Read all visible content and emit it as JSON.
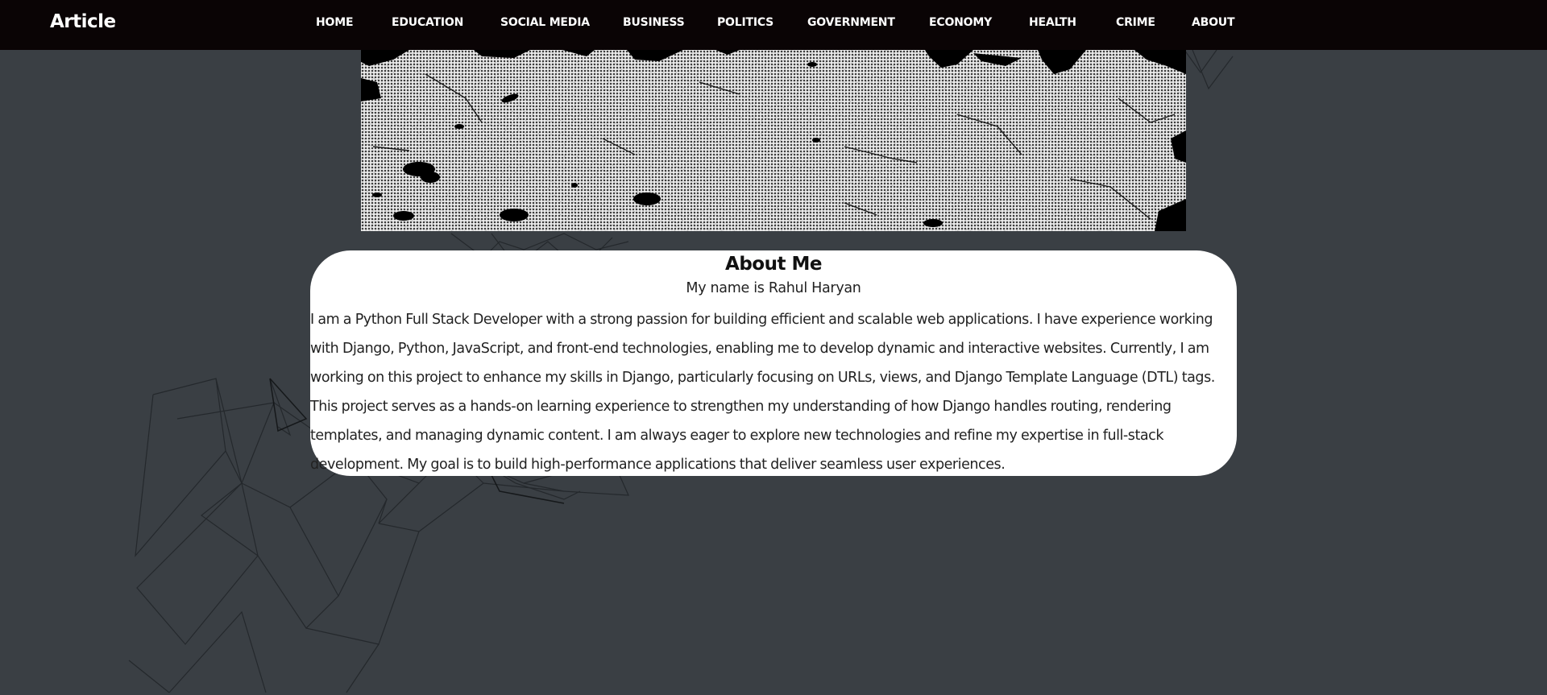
{
  "navbar": {
    "brand": "Article",
    "links": [
      {
        "label": "HOME"
      },
      {
        "label": "EDUCATION"
      },
      {
        "label": "SOCIAL MEDIA"
      },
      {
        "label": "BUSINESS"
      },
      {
        "label": "POLITICS"
      },
      {
        "label": "GOVERNMENT"
      },
      {
        "label": "ECONOMY"
      },
      {
        "label": "HEALTH"
      },
      {
        "label": "CRIME"
      },
      {
        "label": "ABOUT"
      }
    ]
  },
  "about": {
    "title": "About Me",
    "name_line": "My name is Rahul Haryan",
    "body": "I am a Python Full Stack Developer with a strong passion for building efficient and scalable web applications. I have experience working with Django, Python, JavaScript, and front-end technologies, enabling me to develop dynamic and interactive websites. Currently, I am working on this project to enhance my skills in Django, particularly focusing on URLs, views, and Django Template Language (DTL) tags. This project serves as a hands-on learning experience to strengthen my understanding of how Django handles routing, rendering templates, and managing dynamic content. I am always eager to explore new technologies and refine my expertise in full-stack development. My goal is to build high-performance applications that deliver seamless user experiences."
  },
  "colors": {
    "navbar_bg": "#0a0405",
    "page_bg": "#3a3f44",
    "card_bg": "#ffffff"
  }
}
